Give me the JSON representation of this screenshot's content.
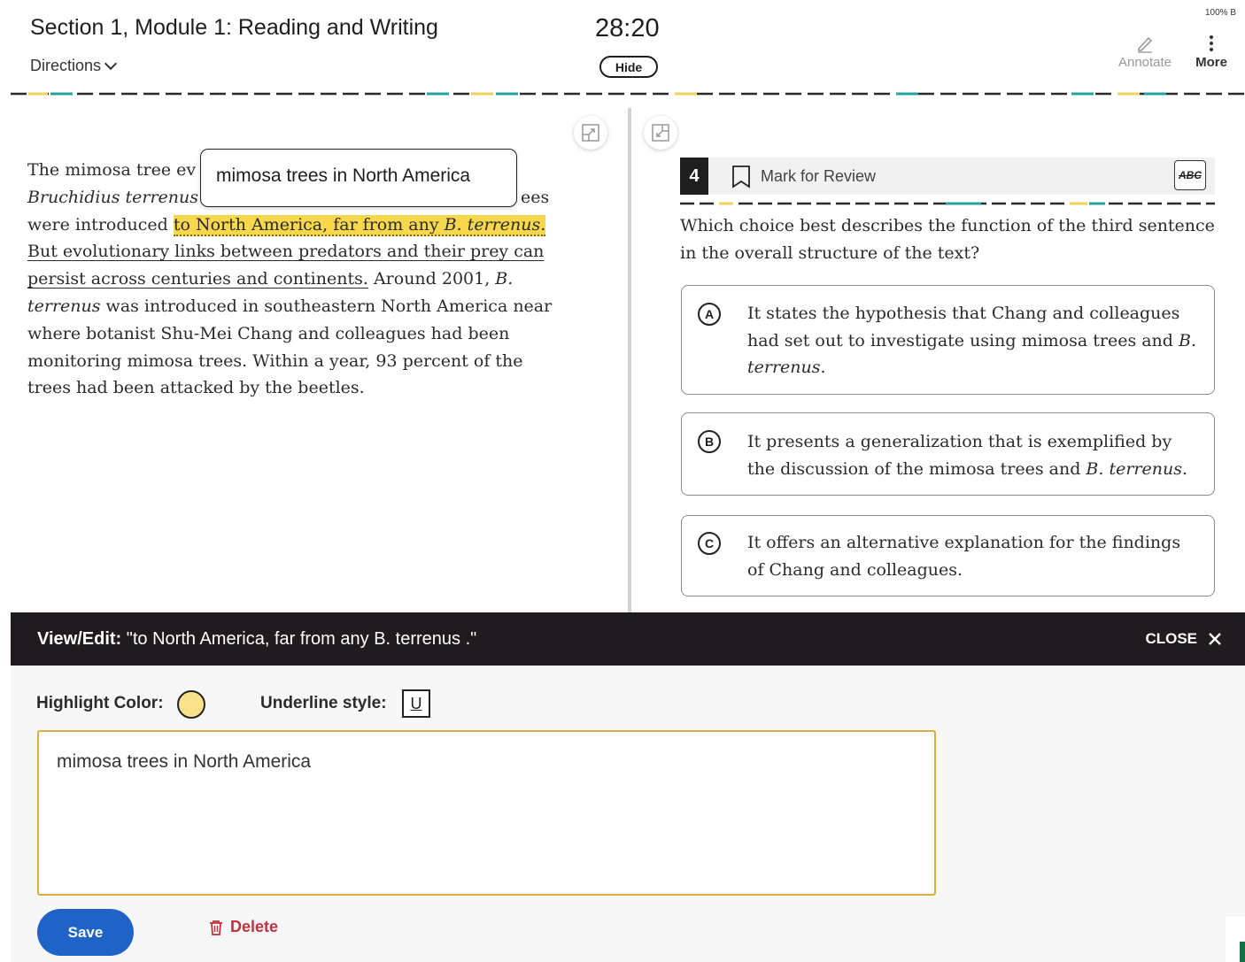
{
  "header": {
    "title": "Section 1, Module 1: Reading and Writing",
    "directions": "Directions",
    "timer": "28:20",
    "hide_label": "Hide",
    "battery": "100% B",
    "annotate_label": "Annotate",
    "more_label": "More"
  },
  "passage": {
    "s1": "The mimosa tree ev",
    "s2": "Bruchidius terrenus",
    "s3": "ees",
    "s4": "were introduced ",
    "hl_a": "to North America, far from any ",
    "hl_b": "B. terrenus",
    "hl_c": ".",
    "ul": "But evolutionary links between predators and their prey can persist across centuries and continents.",
    "s5": " Around 2001, ",
    "s6": "B. terrenus",
    "s7": " was introduced in southeastern North America near where botanist Shu-Mei Chang and colleagues had been monitoring mimosa trees. Within a year, 93 percent of the trees had been attacked by the beetles."
  },
  "tooltip": "mimosa trees in North America",
  "question": {
    "number": "4",
    "mark_label": "Mark for Review",
    "abc_label": "ABC",
    "text": "Which choice best describes the function of the third sentence in the overall structure of the text?",
    "choices": [
      {
        "letter": "A",
        "text_a": "It states the hypothesis that Chang and colleagues had set out to investigate using mimosa trees and ",
        "text_b": "B. terrenus",
        "text_c": "."
      },
      {
        "letter": "B",
        "text_a": "It presents a generalization that is exemplified by the discussion of the mimosa trees and ",
        "text_b": "B. terrenus",
        "text_c": "."
      },
      {
        "letter": "C",
        "text_a": "It offers an alternative explanation for the findings of Chang and colleagues.",
        "text_b": "",
        "text_c": ""
      }
    ]
  },
  "editor": {
    "title_label": "View/Edit:",
    "title_quote": " \"to North America, far from any B. terrenus .\"",
    "close_label": "CLOSE",
    "highlight_label": "Highlight Color:",
    "underline_label": "Underline style:",
    "underline_icon_letter": "U",
    "note_value": "mimosa trees in North America",
    "save_label": "Save",
    "delete_label": "Delete"
  },
  "colors": {
    "highlight": "#f7d74c",
    "swatch": "#f9e28a",
    "note_border": "#d9ae3e",
    "save": "#1e63c5",
    "delete": "#c0323f",
    "editor_bar": "#1f1b1e"
  }
}
